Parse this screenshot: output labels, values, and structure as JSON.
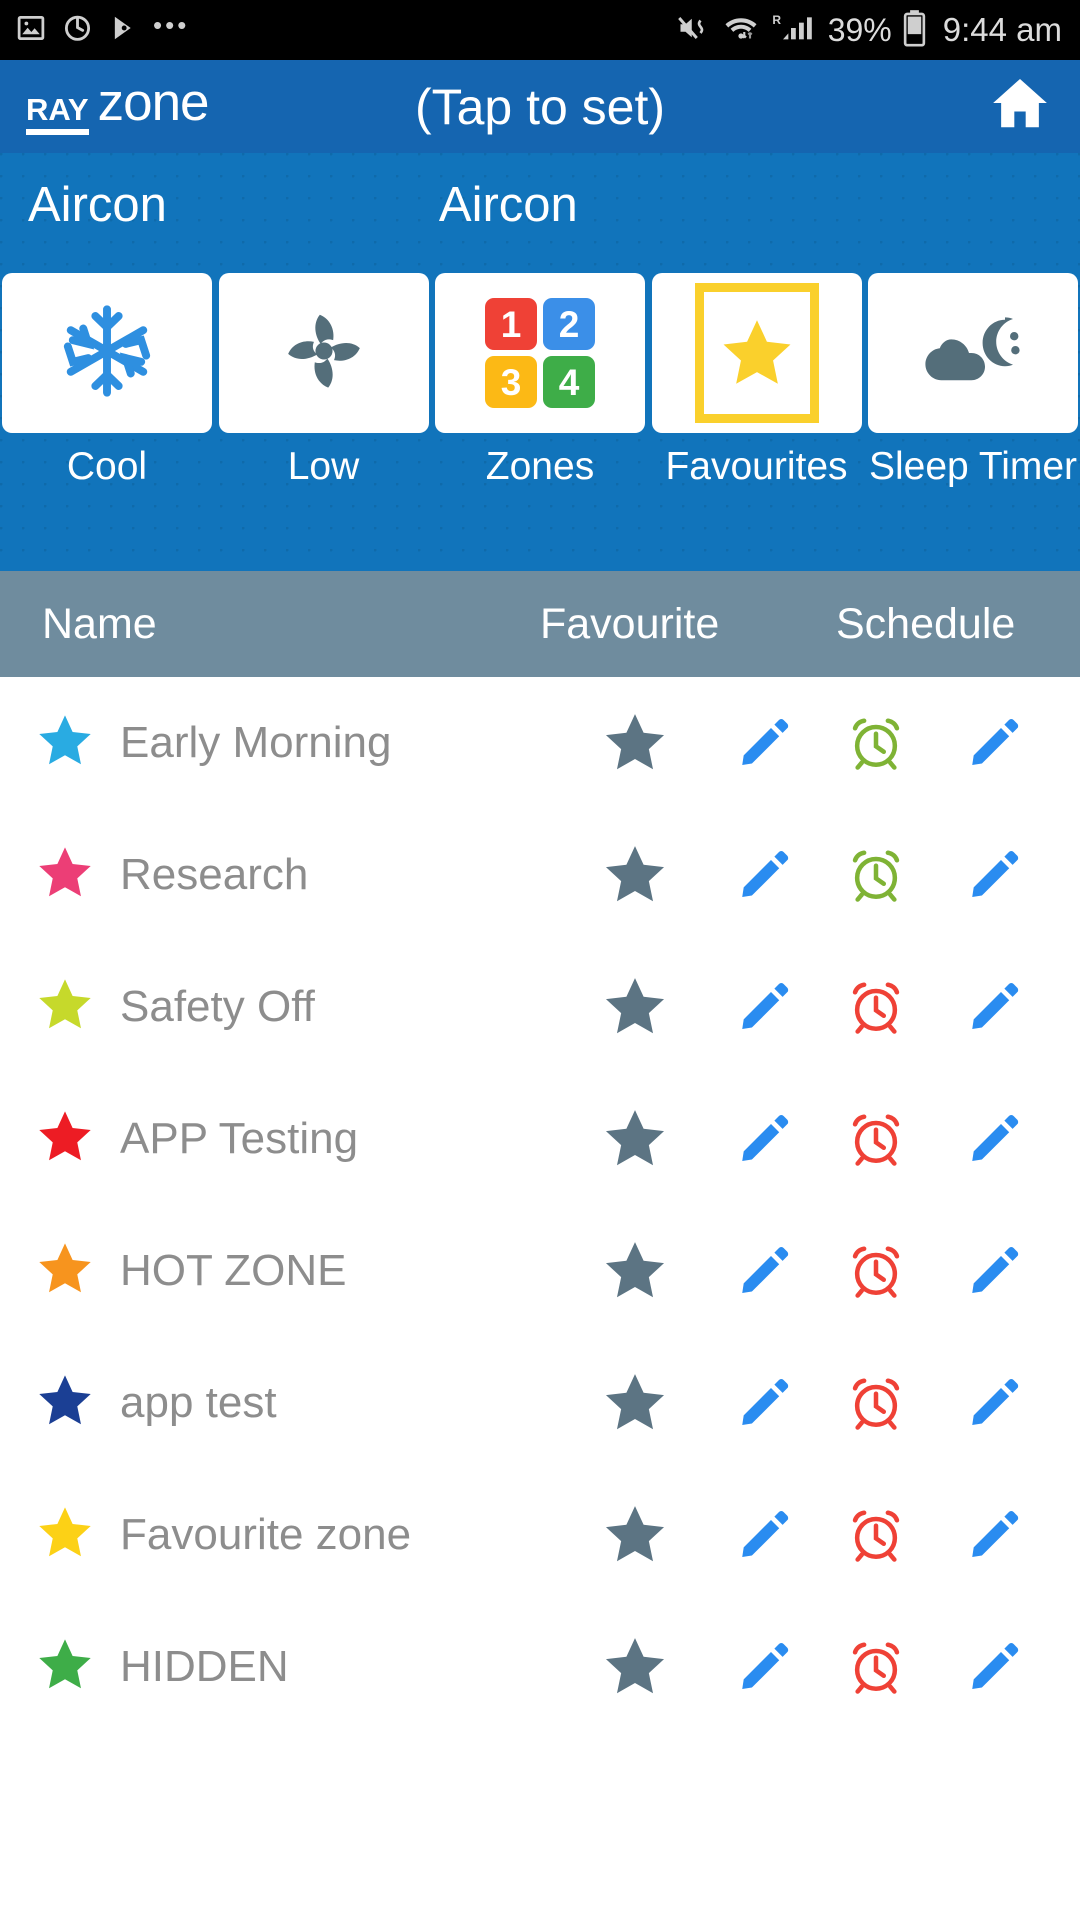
{
  "statusbar": {
    "icons_left": [
      "image-icon",
      "alarm-icon",
      "play-store-icon",
      "more-dots-icon"
    ],
    "icons_right": [
      "mute-vibrate-icon",
      "wifi-icon",
      "roaming-signal-icon"
    ],
    "battery_percent": "39%",
    "battery_icon": "battery-icon",
    "time": "9:44 am"
  },
  "appbar": {
    "logo_primary": "RAY",
    "logo_secondary": "zone",
    "title": "(Tap to set)",
    "home_icon": "home-icon",
    "background": "#1565b0"
  },
  "panel": {
    "background": "#1174bb",
    "label_left": "Aircon",
    "label_right": "Aircon",
    "tiles": [
      {
        "label": "Cool",
        "icon": "snowflake-icon",
        "color": "#2e8fe0",
        "selected": false
      },
      {
        "label": "Low",
        "icon": "fan-icon",
        "color": "#546e7a",
        "selected": false
      },
      {
        "label": "Zones",
        "icon": "zones-grid-icon",
        "selected": false,
        "zones": [
          {
            "number": "1",
            "color": "#ef4136"
          },
          {
            "number": "2",
            "color": "#3b8fe8"
          },
          {
            "number": "3",
            "color": "#fcb915"
          },
          {
            "number": "4",
            "color": "#3ead48"
          }
        ]
      },
      {
        "label": "Favourites",
        "icon": "star-framed-icon",
        "color": "#FAD02C",
        "selected": true
      },
      {
        "label": "Sleep Timer",
        "icon": "cloud-moon-icon",
        "color": "#546e7a",
        "selected": false
      }
    ]
  },
  "table": {
    "header_background": "#6f8c9e",
    "columns": [
      "Name",
      "Favourite",
      "Schedule"
    ],
    "row_icons": {
      "favourite_star": "star-icon",
      "favourite_star_color": "#5c7483",
      "edit_pencil": "pencil-icon",
      "edit_pencil_color": "#2a8cf0",
      "schedule_alarm": "alarm-clock-icon",
      "alarm_on_color": "#7fb335",
      "alarm_off_color": "#ef4136"
    },
    "rows": [
      {
        "name": "Early Morning",
        "star_color": "#29abe2",
        "alarm_active": true
      },
      {
        "name": "Research",
        "star_color": "#ec3e76",
        "alarm_active": true
      },
      {
        "name": "Safety Off",
        "star_color": "#c6d92b",
        "alarm_active": false
      },
      {
        "name": "APP Testing",
        "star_color": "#ed1c24",
        "alarm_active": false
      },
      {
        "name": "HOT ZONE",
        "star_color": "#f7941e",
        "alarm_active": false
      },
      {
        "name": "app test",
        "star_color": "#1b3f94",
        "alarm_active": false
      },
      {
        "name": "Favourite zone",
        "star_color": "#fcd116",
        "alarm_active": false
      },
      {
        "name": "HIDDEN",
        "star_color": "#3ead48",
        "alarm_active": false
      }
    ]
  }
}
